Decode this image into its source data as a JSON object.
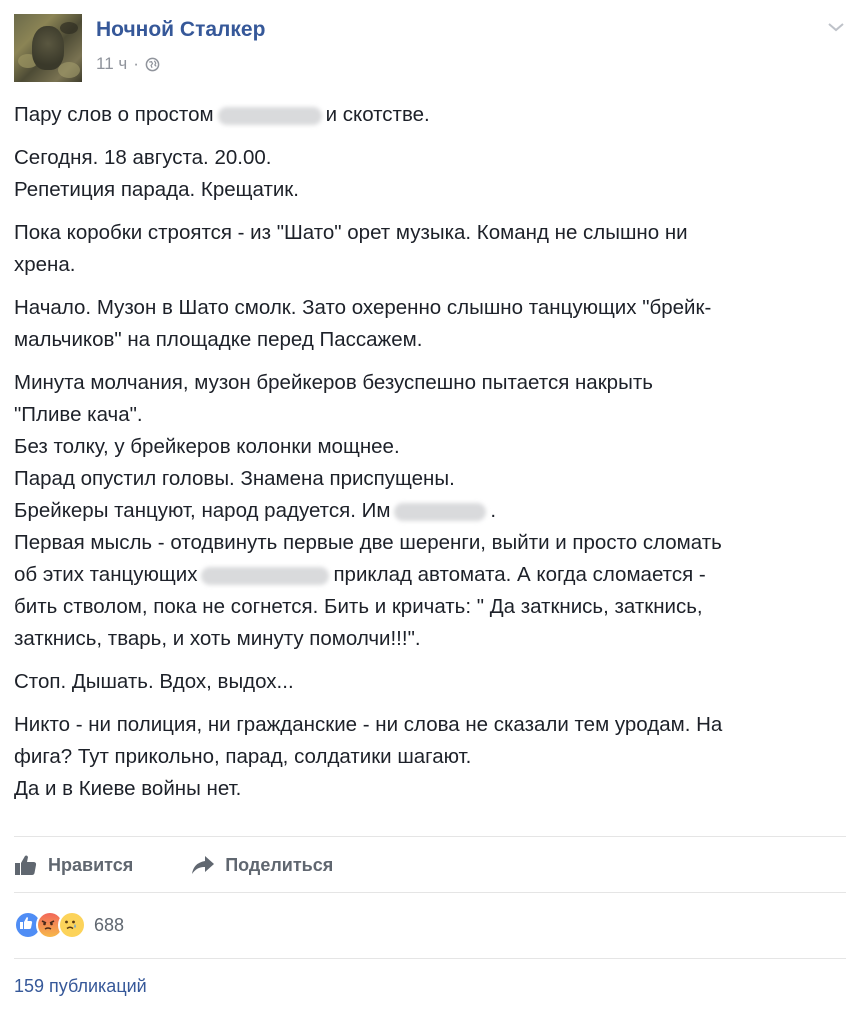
{
  "post": {
    "author": "Ночной Сталкер",
    "time": "11 ч",
    "separator": "·",
    "paragraphs": [
      [
        {
          "text": "Пару слов о простом",
          "blur_after": 104,
          "tail": "и скотстве."
        }
      ],
      [
        {
          "text": "Сегодня. 18 августа. 20.00."
        },
        {
          "text": "Репетиция парада. Крещатик."
        }
      ],
      [
        {
          "text": "Пока коробки строятся - из \"Шато\" орет музыка. Команд не слышно ни"
        },
        {
          "text": "хрена."
        }
      ],
      [
        {
          "text": "Начало. Музон в Шато смолк. Зато охеренно слышно танцующих \"брейк-"
        },
        {
          "text": "мальчиков\" на площадке перед Пассажем."
        }
      ],
      [
        {
          "text": "Минута молчания, музон брейкеров безуспешно пытается накрыть"
        },
        {
          "text": "\"Пливе кача\"."
        },
        {
          "text": "Без толку, у брейкеров колонки мощнее."
        },
        {
          "text": "Парад опустил головы. Знамена приспущены."
        },
        {
          "text": "Брейкеры танцуют, народ радуется. Им",
          "blur_after": 92,
          "tail": "."
        },
        {
          "text": "Первая мысль - отодвинуть первые две шеренги, выйти и просто сломать"
        },
        {
          "text": "об этих танцующих",
          "blur_after": 128,
          "tail": "приклад автомата. А когда сломается -"
        },
        {
          "text": "бить стволом, пока не согнется. Бить и кричать: \" Да заткнись, заткнись,"
        },
        {
          "text": "заткнись, тварь, и хоть минуту помолчи!!!\"."
        }
      ],
      [
        {
          "text": "Стоп. Дышать. Вдох, выдох..."
        }
      ],
      [
        {
          "text": "Никто - ни полиция, ни гражданские - ни слова не сказали тем уродам. На"
        },
        {
          "text": "фига? Тут прикольно, парад, солдатики шагают."
        },
        {
          "text": "Да и в Киеве войны нет."
        }
      ]
    ]
  },
  "actions": {
    "like_label": "Нравится",
    "share_label": "Поделиться"
  },
  "reactions": {
    "count": "688",
    "icons": [
      "like-icon",
      "angry-icon",
      "sad-icon"
    ]
  },
  "shares": {
    "label": "159 публикаций"
  },
  "colors": {
    "link": "#365899",
    "text": "#1d2129",
    "meta": "#90949c",
    "action": "#606770"
  }
}
